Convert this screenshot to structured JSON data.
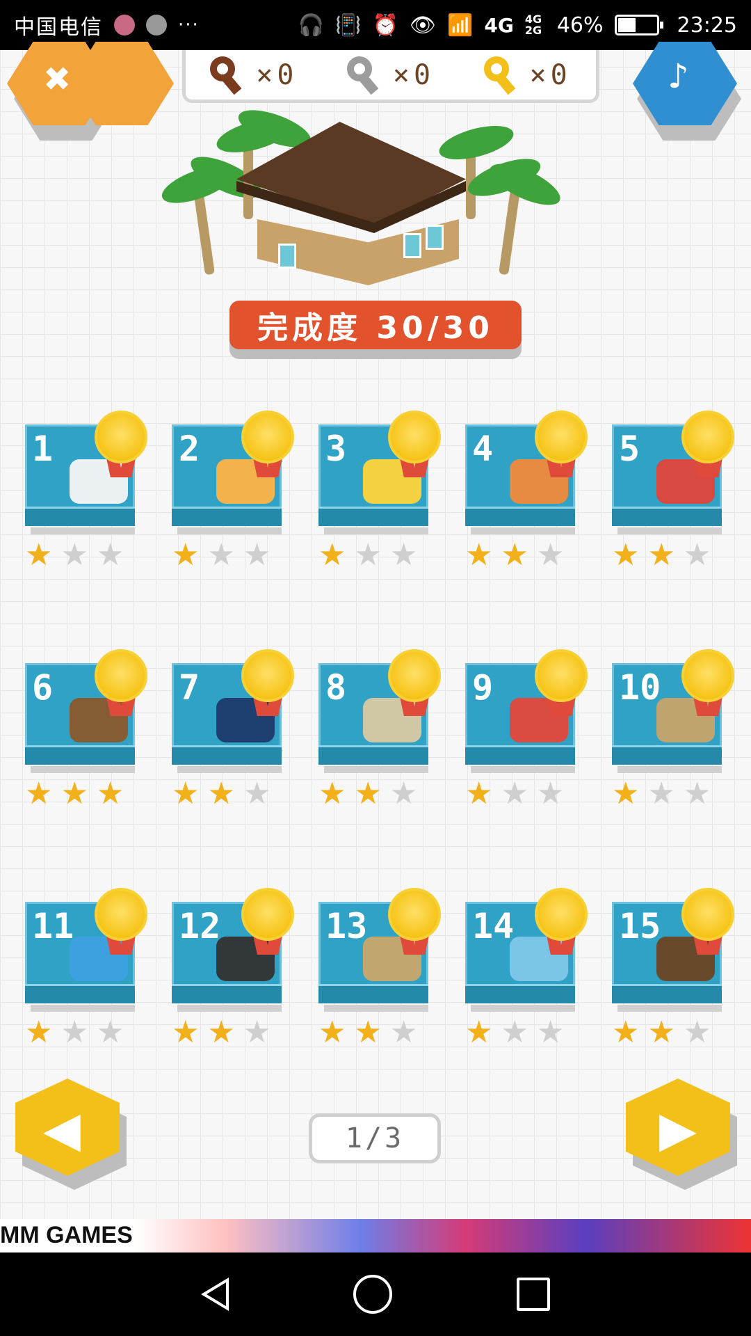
{
  "status_bar": {
    "carrier": "中国电信",
    "more": "···",
    "network": "4G",
    "network_small": "4G 2G",
    "battery_percent": "46%",
    "battery_level": 0.46,
    "time": "23:25"
  },
  "header": {
    "keys": [
      {
        "type": "bronze",
        "count_label": "×0"
      },
      {
        "type": "silver",
        "count_label": "×0"
      },
      {
        "type": "gold",
        "count_label": "×0"
      }
    ],
    "menu_icon": "menu-hex-icon",
    "music_icon": "music-note-icon"
  },
  "hero": {
    "completion_label": "完成度 30/30"
  },
  "levels": [
    {
      "number": "1",
      "stars": 1,
      "badge": true
    },
    {
      "number": "2",
      "stars": 1,
      "badge": true
    },
    {
      "number": "3",
      "stars": 1,
      "badge": true
    },
    {
      "number": "4",
      "stars": 2,
      "badge": true
    },
    {
      "number": "5",
      "stars": 2,
      "badge": true
    },
    {
      "number": "6",
      "stars": 3,
      "badge": true
    },
    {
      "number": "7",
      "stars": 2,
      "badge": true
    },
    {
      "number": "8",
      "stars": 2,
      "badge": true
    },
    {
      "number": "9",
      "stars": 1,
      "badge": true
    },
    {
      "number": "10",
      "stars": 1,
      "badge": true
    },
    {
      "number": "11",
      "stars": 1,
      "badge": true
    },
    {
      "number": "12",
      "stars": 2,
      "badge": true
    },
    {
      "number": "13",
      "stars": 2,
      "badge": true
    },
    {
      "number": "14",
      "stars": 1,
      "badge": true
    },
    {
      "number": "15",
      "stars": 2,
      "badge": true
    }
  ],
  "pagination": {
    "label": "1/3",
    "prev_icon": "left-arrow-icon",
    "next_icon": "right-arrow-icon"
  },
  "ad": {
    "text": "MM GAMES"
  },
  "colors": {
    "card": "#2fa2c6",
    "banner": "#e2522d",
    "nav_hex": "#f2c019",
    "star_on": "#f2b01a",
    "star_off": "#cfcfcf"
  }
}
